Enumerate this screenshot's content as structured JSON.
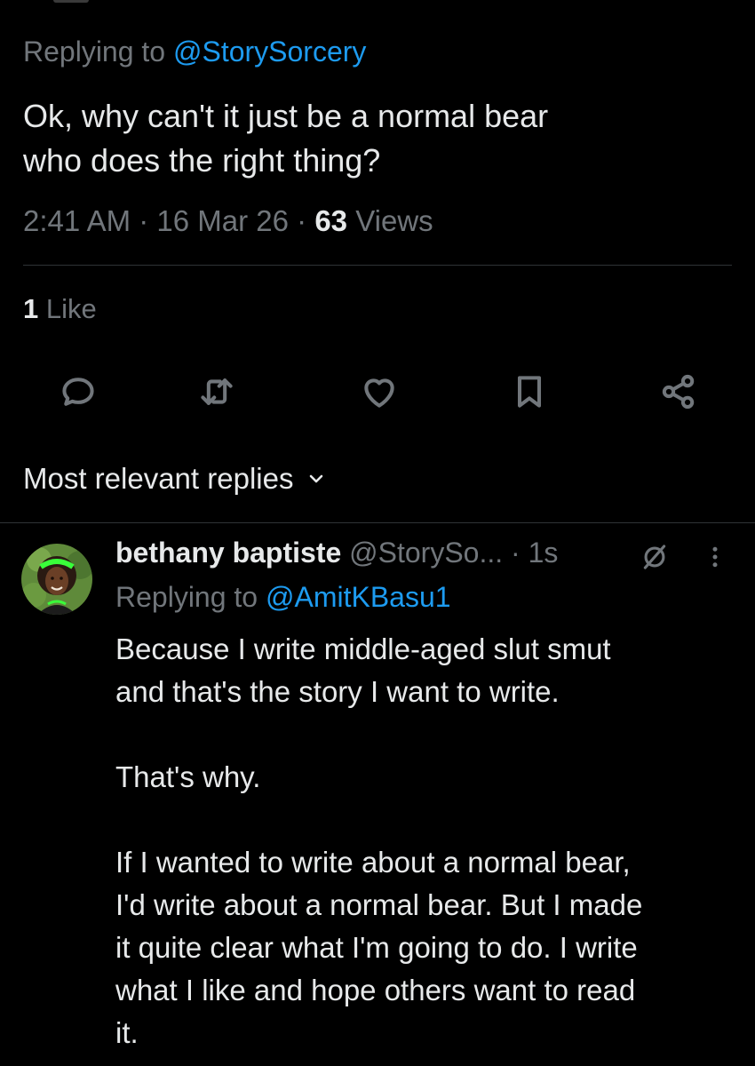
{
  "tweet": {
    "replying_prefix": "Replying to ",
    "replying_handle": "@StorySorcery",
    "text_line1": "Ok, why can't it just be a normal bear",
    "text_line2": "who does the right thing?",
    "time": "2:41 AM",
    "sep1": " · ",
    "date": "16 Mar 26",
    "sep2": " · ",
    "views_count": "63",
    "views_label": " Views",
    "likes_count": "1",
    "likes_label": " Like"
  },
  "actions": {
    "icons": [
      "reply-icon",
      "retweet-icon",
      "like-icon",
      "bookmark-icon",
      "share-icon"
    ]
  },
  "sort": {
    "label": "Most relevant replies"
  },
  "reply": {
    "name": "bethany baptiste",
    "handle": "@StorySo...",
    "time": " · 1s",
    "replying_prefix": "Replying to ",
    "replying_handle": "@AmitKBasu1",
    "p1_line1": "Because I write middle-aged slut smut",
    "p1_line2": "and that's the story I want to write.",
    "p2": "That's why.",
    "p3_line1": "If I wanted to write about a normal bear,",
    "p3_line2": "I'd write about a normal bear. But I made",
    "p3_line3": "it quite clear what I'm going to do. I write",
    "p3_line4": "what I like and hope others want to read",
    "p3_line5": "it."
  },
  "colors": {
    "background": "#000000",
    "text": "#e7e9ea",
    "secondary": "#71767b",
    "link": "#1d9bf0",
    "divider": "#2f3336"
  }
}
